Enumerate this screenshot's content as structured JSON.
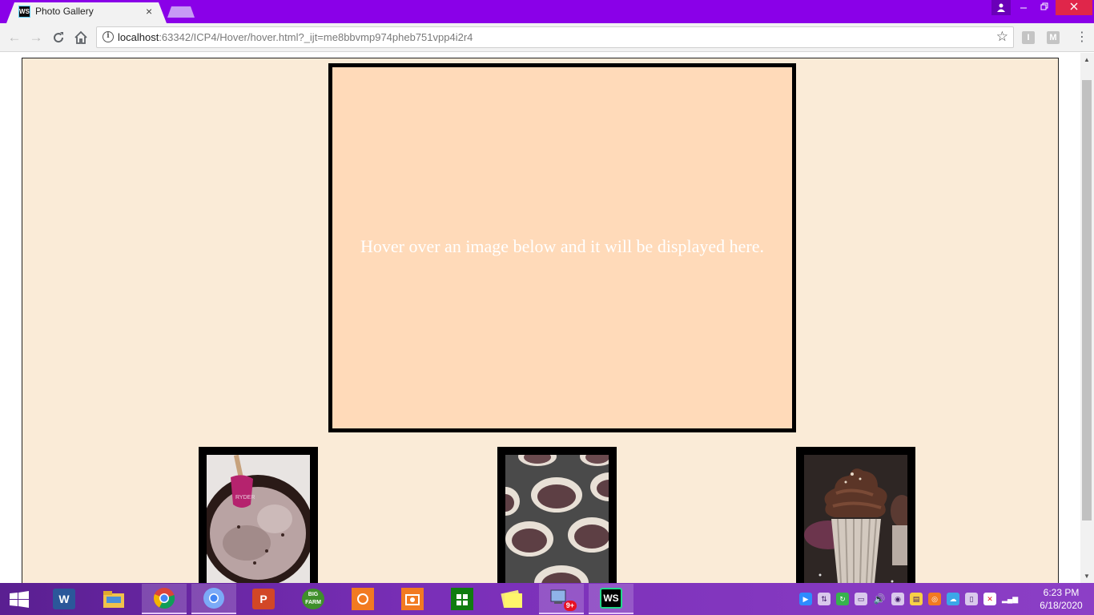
{
  "browser": {
    "tab_favicon": "WS",
    "tab_title": "Photo Gallery",
    "tab_close": "×",
    "url_host": "localhost",
    "url_rest": ":63342/ICP4/Hover/hover.html?_ijt=me8bbvmp974pheb751vpp4i2r4",
    "extensions": [
      "I",
      "M"
    ]
  },
  "page": {
    "background_color": "#faebd7",
    "display_color": "#ffdab9",
    "display_text": "Hover over an image below and it will be displayed here.",
    "thumbnails": [
      {
        "subject": "chocolate batter with spatula"
      },
      {
        "subject": "cupcake liners in muffin tin"
      },
      {
        "subject": "frosted chocolate cupcake"
      }
    ]
  },
  "taskbar": {
    "apps": [
      {
        "name": "word-icon",
        "label": "W"
      },
      {
        "name": "file-explorer-icon",
        "label": ""
      },
      {
        "name": "chrome-icon",
        "label": ""
      },
      {
        "name": "chrome-icon-2",
        "label": ""
      },
      {
        "name": "powerpoint-icon",
        "label": "P"
      },
      {
        "name": "big-farm-icon",
        "label": "BIG FARM"
      },
      {
        "name": "screenshot-tool-icon",
        "label": ""
      },
      {
        "name": "camera-app-icon",
        "label": ""
      },
      {
        "name": "store-icon",
        "label": ""
      },
      {
        "name": "sticky-notes-icon",
        "label": ""
      },
      {
        "name": "network-app-icon",
        "label": "9+"
      },
      {
        "name": "webstorm-icon",
        "label": "WS"
      }
    ],
    "time": "6:23 PM",
    "date": "6/18/2020"
  }
}
